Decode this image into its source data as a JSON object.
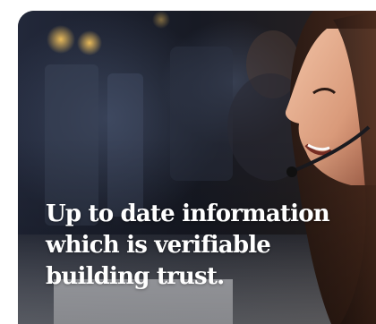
{
  "hero": {
    "headline_lines": [
      "Up to date information",
      "which is verifiable",
      "building trust."
    ],
    "image_subject": "call-center-agent-with-headset",
    "colors": {
      "text": "#ffffff",
      "background_dark": "#1a1d26",
      "accent_lights": "#e0a84a"
    }
  }
}
